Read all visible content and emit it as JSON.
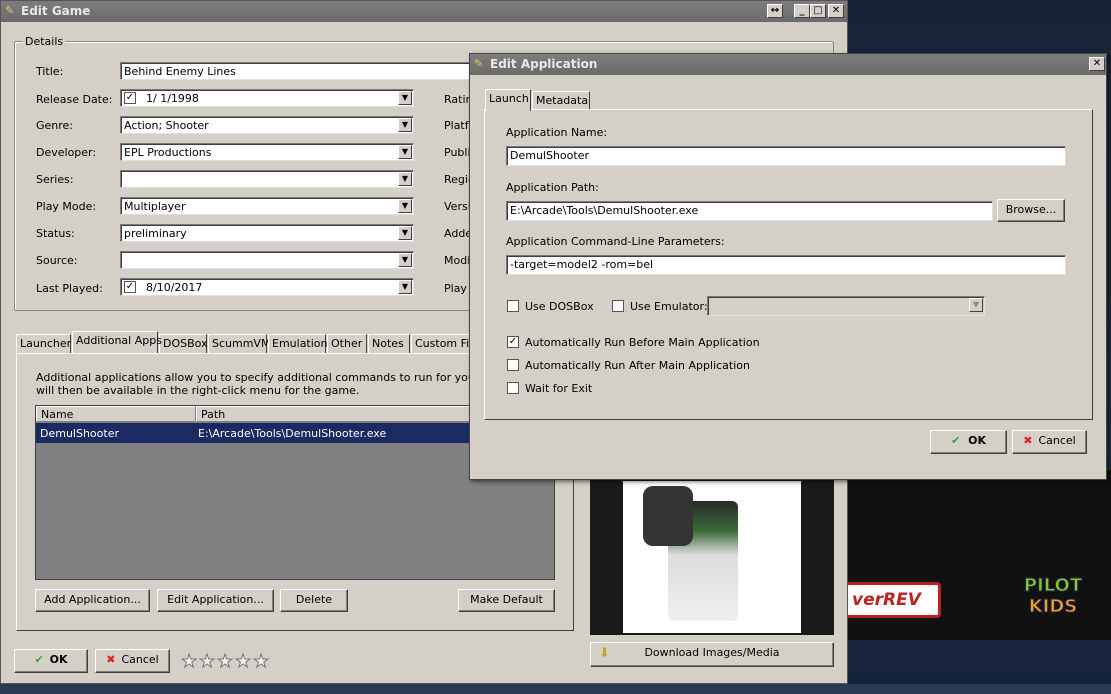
{
  "edit_game": {
    "title": "Edit Game",
    "details_label": "Details",
    "fields": {
      "title_label": "Title:",
      "title_value": "Behind Enemy Lines",
      "release_label": "Release Date:",
      "release_value": "1/  1/1998",
      "genre_label": "Genre:",
      "genre_value": "Action; Shooter",
      "developer_label": "Developer:",
      "developer_value": "EPL Productions",
      "series_label": "Series:",
      "series_value": "",
      "playmode_label": "Play Mode:",
      "playmode_value": "Multiplayer",
      "status_label": "Status:",
      "status_value": "preliminary",
      "source_label": "Source:",
      "source_value": "",
      "lastplayed_label": "Last Played:",
      "lastplayed_value": "8/10/2017"
    },
    "right_labels": [
      "Ratin",
      "Platfo",
      "Publis",
      "Regio",
      "Versio",
      "Adde",
      "Modif",
      "Play C"
    ],
    "tabs": [
      "Launcher",
      "Additional Apps",
      "DOSBox",
      "ScummVM",
      "Emulation",
      "Other",
      "Notes",
      "Custom Fiel"
    ],
    "description": "Additional applications allow you to specify additional commands to run for your game.  The",
    "description2": "will then be available in the right-click menu for the game.",
    "list": {
      "columns": [
        "Name",
        "Path"
      ],
      "rows": [
        {
          "name": "DemulShooter",
          "path": "E:\\Arcade\\Tools\\DemulShooter.exe"
        }
      ]
    },
    "buttons": {
      "add": "Add Application...",
      "edit": "Edit Application...",
      "delete": "Delete",
      "default": "Make Default",
      "ok": "OK",
      "cancel": "Cancel",
      "download": "Download Images/Media"
    },
    "rating_stars": 5,
    "rating_value": 0
  },
  "edit_app": {
    "title": "Edit Application",
    "tabs": [
      "Launch",
      "Metadata"
    ],
    "app_name_label": "Application Name:",
    "app_name_value": "DemulShooter",
    "app_path_label": "Application Path:",
    "app_path_value": "E:\\Arcade\\Tools\\DemulShooter.exe",
    "browse_label": "Browse...",
    "cmdline_label": "Application Command-Line Parameters:",
    "cmdline_value": "-target=model2 -rom=bel",
    "use_dosbox_label": "Use DOSBox",
    "use_emulator_label": "Use Emulator:",
    "emulator_value": "",
    "auto_before_label": "Automatically Run Before Main Application",
    "auto_after_label": "Automatically Run After Main Application",
    "wait_exit_label": "Wait for Exit",
    "checks": {
      "use_dosbox": false,
      "use_emulator": false,
      "auto_before": true,
      "auto_after": false,
      "wait_exit": false
    },
    "ok_label": "OK",
    "cancel_label": "Cancel"
  },
  "desktop": {
    "logo_rev": "verREV",
    "logo_pilot": "PILOT",
    "logo_kids": "KIDS"
  },
  "colors": {
    "accent": "#1c2a63",
    "ok_check": "#3aa33a",
    "cancel_x": "#d22"
  }
}
